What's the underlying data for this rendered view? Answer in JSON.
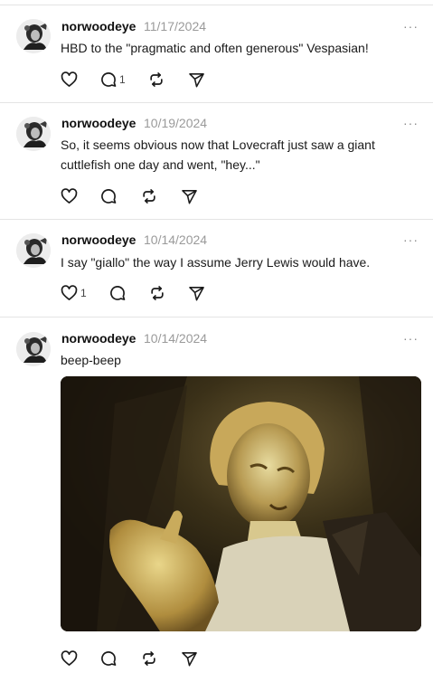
{
  "posts": [
    {
      "username": "norwoodeye",
      "date": "11/17/2024",
      "text": "HBD to the \"pragmatic and often generous\" Vespasian!",
      "like_count": "",
      "reply_count": "1",
      "more_icon": "ellipsis-icon"
    },
    {
      "username": "norwoodeye",
      "date": "10/19/2024",
      "text": "So, it seems obvious now that Lovecraft just saw a giant cuttlefish one day and went, \"hey...\"",
      "like_count": "",
      "reply_count": "",
      "more_icon": "ellipsis-icon"
    },
    {
      "username": "norwoodeye",
      "date": "10/14/2024",
      "text": "I say \"giallo\" the way I assume Jerry Lewis would have.",
      "like_count": "1",
      "reply_count": "",
      "more_icon": "ellipsis-icon"
    },
    {
      "username": "norwoodeye",
      "date": "10/14/2024",
      "text": "beep-beep",
      "like_count": "",
      "reply_count": "",
      "more_icon": "ellipsis-icon",
      "media": "photo"
    }
  ],
  "ui": {
    "more": "···"
  },
  "icons": {
    "like": "heart-icon",
    "reply": "comment-icon",
    "repost": "repost-icon",
    "share": "send-icon"
  },
  "colors": {
    "text": "#1a1a1a",
    "muted": "#9a9a9a",
    "divider": "#e4e4e4",
    "icon": "#1a1a1a"
  }
}
